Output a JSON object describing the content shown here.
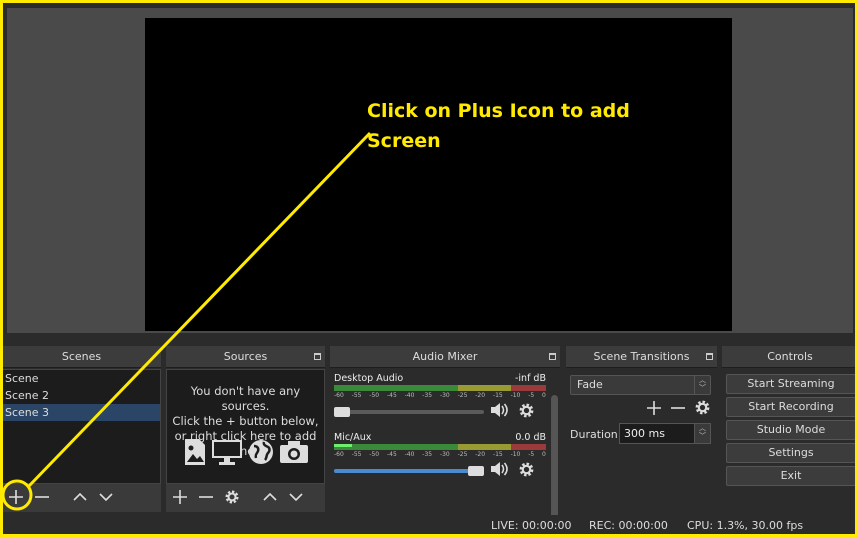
{
  "scenes": {
    "title": "Scenes",
    "items": [
      "Scene",
      "Scene 2",
      "Scene 3"
    ],
    "selected_index": 2,
    "toolbar": {
      "add": "+",
      "remove": "−",
      "up": "⌃",
      "down": "⌄"
    }
  },
  "sources": {
    "title": "Sources",
    "empty_message": "You don't have any sources.\nClick the + button below,\nor right click here to add one."
  },
  "mixer": {
    "title": "Audio Mixer",
    "channels": [
      {
        "name": "Desktop Audio",
        "db": "-inf dB",
        "volume_fraction": 0.0
      },
      {
        "name": "Mic/Aux",
        "db": "0.0 dB",
        "volume_fraction": 1.0
      }
    ],
    "scale": [
      "-60",
      "-55",
      "-50",
      "-45",
      "-40",
      "-35",
      "-30",
      "-25",
      "-20",
      "-15",
      "-10",
      "-5",
      "0"
    ]
  },
  "transitions": {
    "title": "Scene Transitions",
    "selected": "Fade",
    "duration_label": "Duration",
    "duration_value": "300 ms"
  },
  "controls": {
    "title": "Controls",
    "buttons": [
      "Start Streaming",
      "Start Recording",
      "Studio Mode",
      "Settings",
      "Exit"
    ]
  },
  "status": {
    "live": "LIVE: 00:00:00",
    "rec": "REC: 00:00:00",
    "cpu": "CPU: 1.3%, 30.00 fps"
  },
  "annotation": {
    "text": "Click on Plus Icon to add\nScreen",
    "color": "#ffea00"
  },
  "colors": {
    "selection": "#2a4566",
    "accent_slider": "#4a8ad0",
    "annotation": "#ffea00"
  }
}
